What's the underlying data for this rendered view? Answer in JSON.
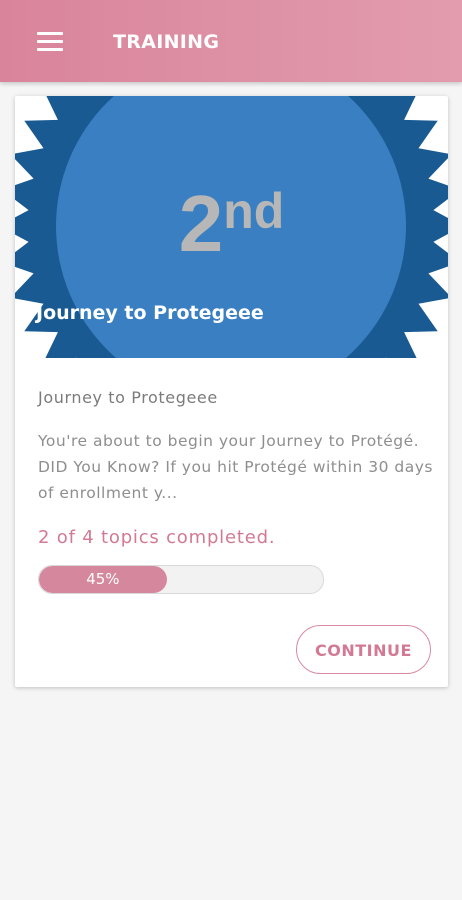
{
  "header": {
    "title": "TRAINING",
    "menu_icon": "hamburger-menu-icon",
    "background_color": "#d9849b"
  },
  "course": {
    "badge": {
      "rank_number": "2",
      "rank_suffix": "nd",
      "banner_title": "Journey to Protegeee",
      "badge_color": "#3a7fc1",
      "seal_color": "#1a5a92"
    },
    "title": "Journey to Protegeee",
    "description": "You're about to begin your Journey to Protégé. DID You Know? If you hit Protégé within 30 days of enrollment y...",
    "progress_text": "2 of 4 topics completed.",
    "progress_percent": 45,
    "progress_label": "45%",
    "continue_label": "CONTINUE",
    "accent_color": "#d27a93"
  }
}
